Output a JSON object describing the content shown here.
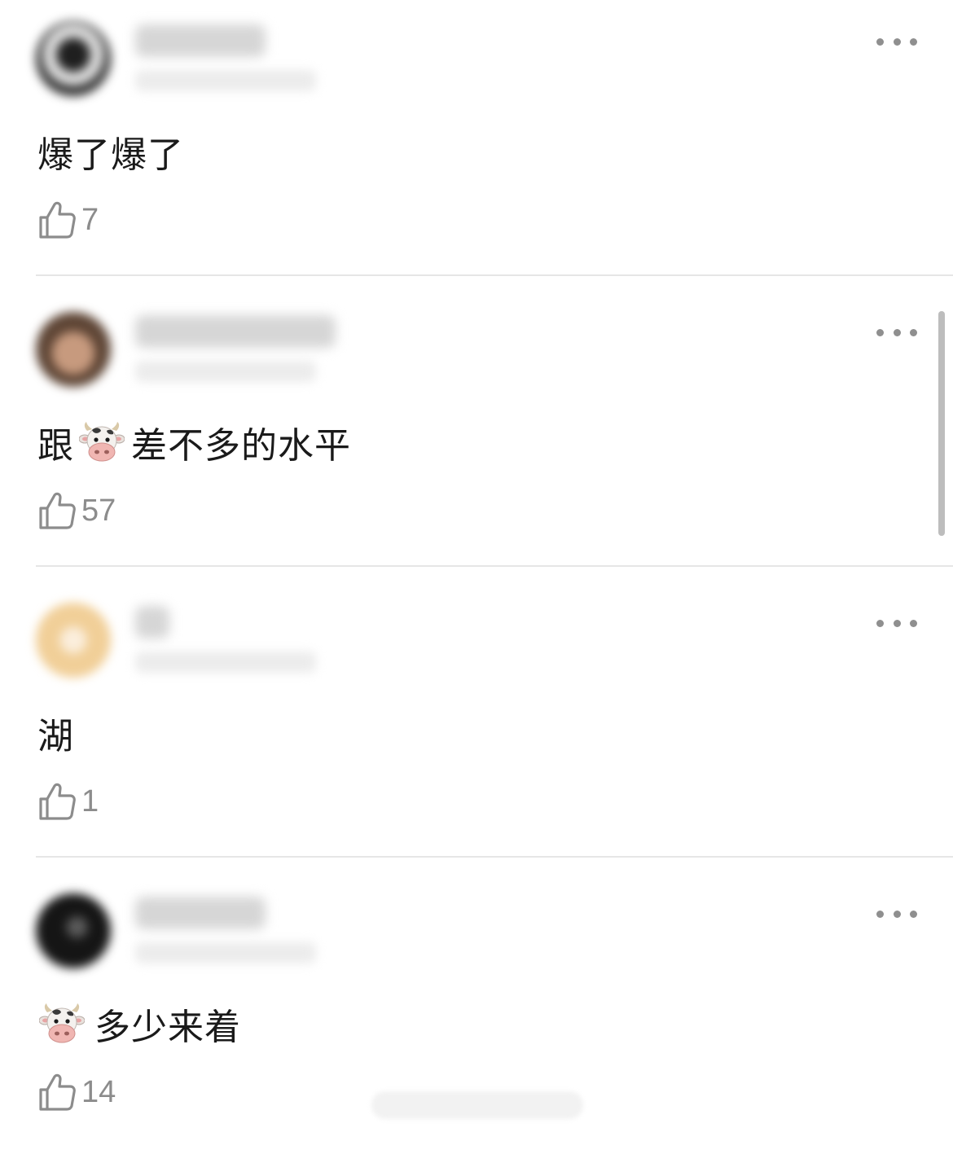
{
  "comments": [
    {
      "text_before": "",
      "emoji": "",
      "text_after": "爆了爆了",
      "likes": "7",
      "avatar_color": "#2a2a2a",
      "avatar_bg": "#e2e2e2"
    },
    {
      "text_before": "跟",
      "emoji": "cow-face",
      "text_after": "差不多的水平",
      "likes": "57",
      "avatar_color": "#7a5a45",
      "avatar_bg": "#caa58c"
    },
    {
      "text_before": "",
      "emoji": "",
      "text_after": "湖",
      "likes": "1",
      "avatar_color": "#f3d7a8",
      "avatar_bg": "#f7e6c8"
    },
    {
      "text_before": "",
      "emoji": "cow-face",
      "text_after": "多少来着",
      "likes": "14",
      "avatar_color": "#1e1e1e",
      "avatar_bg": "#4a4a4a"
    }
  ],
  "icons": {
    "like": "thumbs-up-outline-icon",
    "more": "more-horizontal-icon",
    "emoji": "cow-face-emoji"
  },
  "colors": {
    "text": "#1a1a1a",
    "like_count": "#8c8c8c",
    "more_dots": "#8f8f8f",
    "divider": "#e6e6e6",
    "scrollbar": "#bdbdbd"
  }
}
